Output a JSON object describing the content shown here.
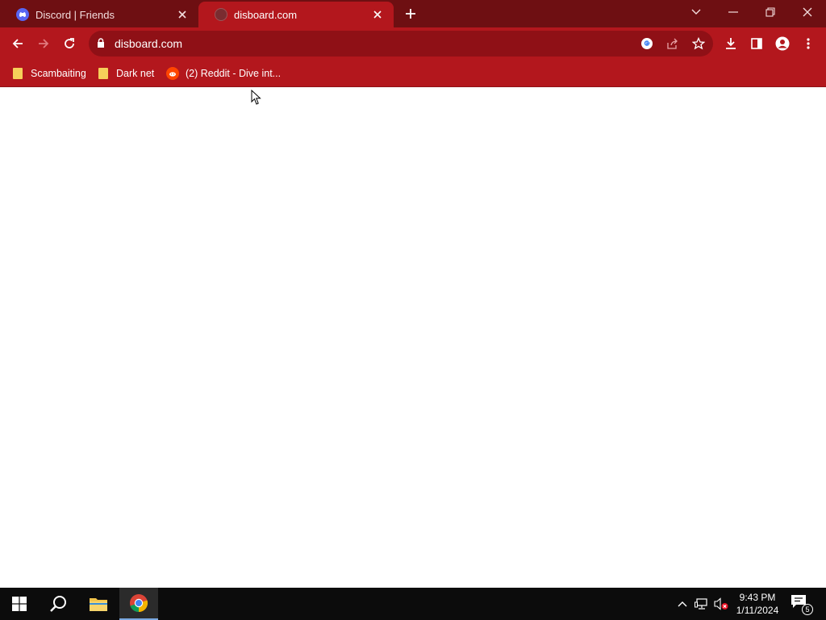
{
  "browser": {
    "tabs": [
      {
        "title": "Discord | Friends",
        "icon": "discord-icon",
        "active": false
      },
      {
        "title": "disboard.com",
        "icon": "globe-icon",
        "active": true
      }
    ],
    "address_bar": {
      "url": "disboard.com"
    },
    "bookmarks": [
      {
        "label": "Scambaiting",
        "icon": "folder-icon"
      },
      {
        "label": "Dark net",
        "icon": "folder-icon"
      },
      {
        "label": "(2) Reddit - Dive int...",
        "icon": "reddit-icon"
      }
    ],
    "theme_colors": {
      "tabstrip": "#6e0f12",
      "toolbar": "#b3171d",
      "omnibox": "#8f1016"
    }
  },
  "taskbar": {
    "clock_time": "9:43 PM",
    "clock_date": "1/11/2024",
    "notification_count": "5"
  }
}
